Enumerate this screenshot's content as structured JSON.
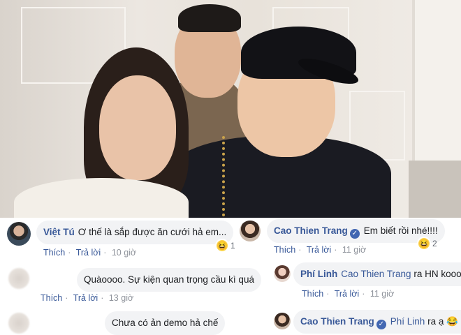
{
  "photo": {
    "alt_subject": ""
  },
  "comments": {
    "c1": {
      "author": "Việt Tú",
      "text": "Ơ thế là sắp được ăn cưới hả em...",
      "reaction_icon": "haha-emoji",
      "reaction_count": "1",
      "like": "Thích",
      "reply": "Trả lời",
      "time": "10 giờ"
    },
    "c2": {
      "text": "Quàoooo. Sự kiện quan trọng cầu kì quá",
      "like": "Thích",
      "reply": "Trả lời",
      "time": "13 giờ"
    },
    "c3": {
      "text": "Chưa có ản demo hả chế"
    },
    "r1": {
      "author": "Cao Thien Trang",
      "text": "Em biết rồi nhé!!!!",
      "reaction_icon": "haha-emoji",
      "reaction_count": "2",
      "like": "Thích",
      "reply": "Trả lời",
      "time": "11 giờ"
    },
    "r2": {
      "author": "Phí Linh",
      "mention": "Cao Thien Trang",
      "text": "ra HN kooo",
      "like": "Thích",
      "reply": "Trả lời",
      "time": "11 giờ"
    },
    "r3": {
      "author": "Cao Thien Trang",
      "mention": "Phí Linh",
      "text": "ra ạ",
      "emoji": "😂"
    }
  },
  "colors": {
    "link": "#385898",
    "bubble": "#f2f3f5",
    "meta": "#90949c",
    "verified": "#4267b2"
  }
}
